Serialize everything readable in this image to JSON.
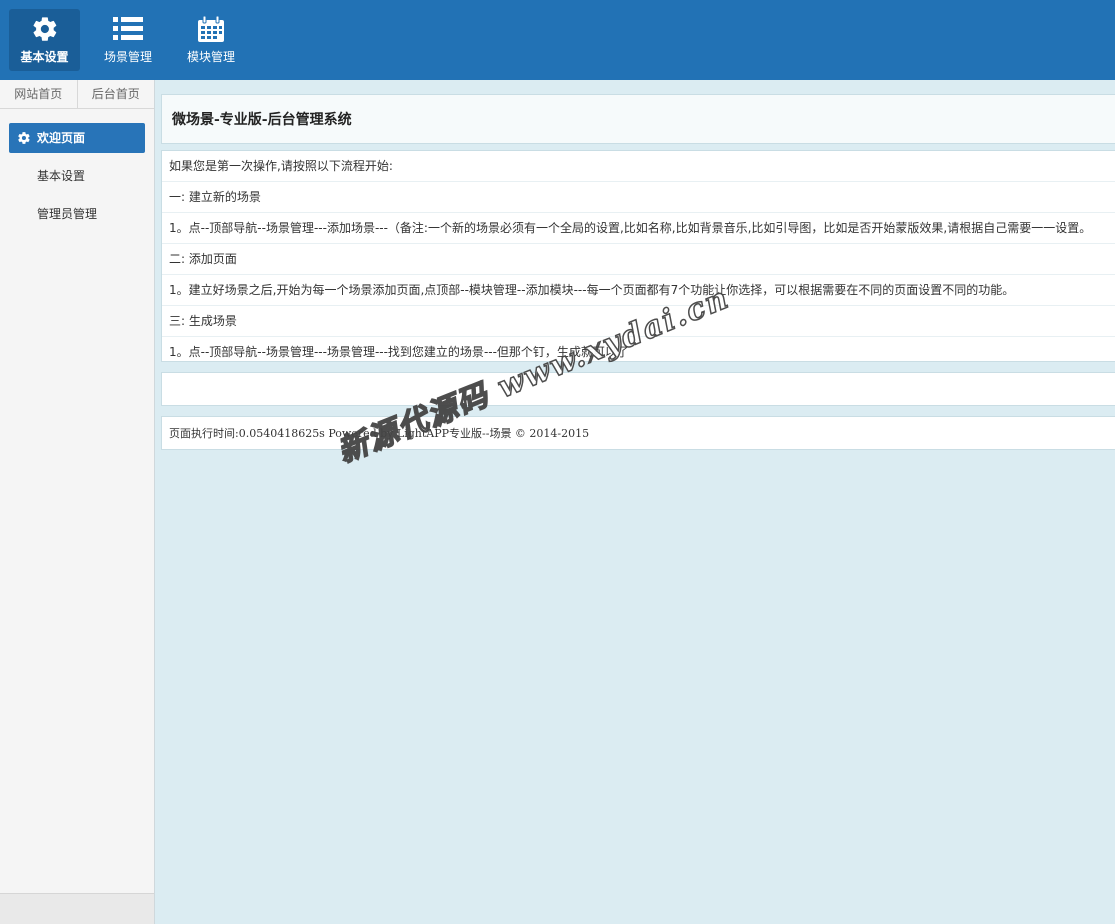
{
  "topnav": {
    "items": [
      {
        "label": "基本设置",
        "icon": "gear-icon"
      },
      {
        "label": "场景管理",
        "icon": "list-icon"
      },
      {
        "label": "模块管理",
        "icon": "calendar-icon"
      }
    ]
  },
  "sidebar": {
    "tabs": [
      "网站首页",
      "后台首页"
    ],
    "menu": [
      "欢迎页面",
      "基本设置",
      "管理员管理"
    ]
  },
  "main": {
    "title": "微场景-专业版-后台管理系统",
    "guide": [
      "如果您是第一次操作,请按照以下流程开始:",
      "一: 建立新的场景",
      "1。点--顶部导航--场景管理---添加场景---（备注:一个新的场景必须有一个全局的设置,比如名称,比如背景音乐,比如引导图，比如是否开始蒙版效果,请根据自己需要一一设置。",
      "二: 添加页面",
      "1。建立好场景之后,开始为每一个场景添加页面,点顶部--模块管理--添加模块---每一个页面都有7个功能让你选择，可以根据需要在不同的页面设置不同的功能。",
      "三: 生成场景",
      "1。点--顶部导航--场景管理---场景管理---找到您建立的场景---但那个钉，生成就可以了"
    ],
    "footer": "页面执行时间:0.0540418625s Powered by LightAPP专业版--场景 © 2014-2015",
    "watermark": "新源代源码 www.xydai.cn"
  },
  "colors": {
    "topbar": "#2272b5",
    "active": "#2874b8",
    "background": "#dbecf2"
  }
}
